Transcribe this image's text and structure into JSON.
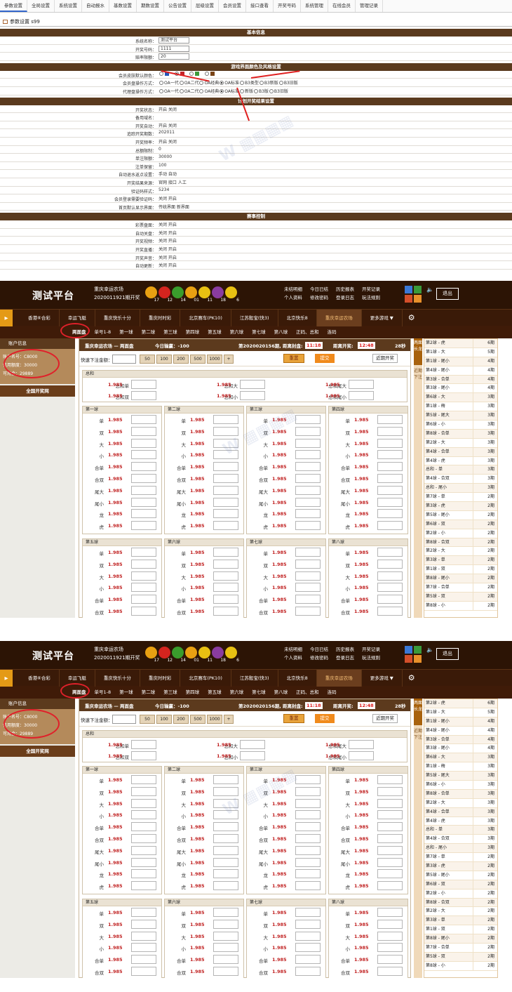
{
  "admin": {
    "tabs": [
      "参数设置",
      "全局设置",
      "系统设置",
      "自动报水",
      "基数设置",
      "期数设置",
      "公告设置",
      "层级设置",
      "会员设置",
      "接口查看",
      "开奖号码",
      "系统管理",
      "在线会员",
      "管理记录"
    ],
    "crumb": "参数设置 s99",
    "h1": "基本信息",
    "rows1": [
      {
        "label": "系统名称：",
        "value": "测试平台"
      },
      {
        "label": "开奖号码：",
        "value": "1111"
      },
      {
        "label": "赔率限额：",
        "value": "20"
      }
    ],
    "h2": "游戏界面颜色及风格设置",
    "color_row": {
      "label": "会员皮肤默认颜色："
    },
    "rows_style": [
      {
        "label": "会员盘操作方式：",
        "options": [
          "OA一代",
          "OA二代",
          "OA经典",
          "OA标准",
          "B3类型",
          "B3新版",
          "B3旧版"
        ]
      },
      {
        "label": "代理盘操作方式：",
        "options": [
          "OA一代",
          "OA二代",
          "OA经典",
          "OA标准",
          "新版",
          "B3版",
          "B3旧版"
        ]
      }
    ],
    "h3": "计划开奖结果设置",
    "rows3": [
      {
        "label": "开奖状态：",
        "value": "开启 关闭"
      },
      {
        "label": "备用域名：",
        "value": ""
      },
      {
        "label": "开奖自动：",
        "value": "开启 关闭"
      },
      {
        "label": "追踪开奖期数：",
        "value": "202011"
      },
      {
        "label": "开奖频率：",
        "value": "开启 关闭"
      },
      {
        "label": "总额限制：",
        "value": "0"
      },
      {
        "label": "单注限额：",
        "value": "30000"
      },
      {
        "label": "注单保留：",
        "value": "100"
      },
      {
        "label": "自动退水返点设置：",
        "value": "手动 自动"
      },
      {
        "label": "开奖结果来源：",
        "value": "官网 接口 人工"
      },
      {
        "label": "验证码样式：",
        "value": "5234"
      },
      {
        "label": "会员登录需要验证码：",
        "value": "关闭 开启"
      },
      {
        "label": "首页默认显示界面：",
        "value": "传统界面 新界面"
      }
    ],
    "h4": "赛事控制",
    "rows4": [
      {
        "label": "彩票盘面：",
        "value": "关闭 开启"
      },
      {
        "label": "自动关盘：",
        "value": "关闭 开启"
      },
      {
        "label": "开奖视频：",
        "value": "关闭 开启"
      },
      {
        "label": "开奖直播：",
        "value": "关闭 开启"
      },
      {
        "label": "开奖声音：",
        "value": "关闭 开启"
      },
      {
        "label": "自动更新：",
        "value": "关闭 开启"
      }
    ]
  },
  "game": {
    "logo": "测试平台",
    "lottery_name": "重庆幸运农场",
    "draw_info": "2020011921期开奖",
    "balls": [
      "17",
      "12",
      "14",
      "01",
      "11",
      "18",
      "6"
    ],
    "ball_colors": [
      "#e8a012",
      "#d4241e",
      "#3a9c2c",
      "#e8a012",
      "#e8c012",
      "#8a3ca0",
      "#e8c012"
    ],
    "links": [
      "未结明细",
      "今日已结",
      "历史报表",
      "开奖记录",
      "个人资料",
      "修改密码",
      "登录日志",
      "玩法规则"
    ],
    "exit": "退出",
    "nav": [
      "香港⑥合彩",
      "幸运飞艇",
      "重庆快乐十分",
      "重庆时时彩",
      "北京赛车(PK10)",
      "江苏骰宝(快3)",
      "北京快乐8",
      "重庆幸运农场",
      "更多游戏 ▼"
    ],
    "sub": [
      "两面盘",
      "单号1-8",
      "第一球",
      "第二球",
      "第三球",
      "第四球",
      "第五球",
      "第六球",
      "第七球",
      "第八球",
      "正码、总和",
      "连码"
    ],
    "side_title": "账户信息",
    "account": [
      "账户名号：C8000",
      "信用额度：30000",
      "可用金：29889"
    ],
    "open_btn": "全国开奖网",
    "head_title": "重庆幸运农场 — 两面盘",
    "today": "今日输赢：-100",
    "issue": "第2020020156期, 距离封盘:",
    "close_time": "11:18",
    "open_label": "距离开奖:",
    "open_time": "12:48",
    "sec": "28秒",
    "quick_label": "快速下注金额：",
    "chips": [
      "50",
      "100",
      "200",
      "500",
      "1000",
      "+"
    ],
    "reset": "重置",
    "submit": "提交",
    "recent": "近期开奖",
    "total_title": "总和",
    "total": [
      "总和单",
      "总和双",
      "总和大",
      "总和小",
      "总和尾大",
      "总和尾小"
    ],
    "ball_titles": [
      "第一球",
      "第二球",
      "第三球",
      "第四球",
      "第五球",
      "第六球",
      "第七球",
      "第八球"
    ],
    "ball_items": [
      "单",
      "双",
      "大",
      "小",
      "合单",
      "合双",
      "尾大",
      "尾小",
      "龙",
      "虎"
    ],
    "odds": "1.985",
    "vtab1": "两面长龙",
    "vtab2": "近期下注",
    "long": [
      [
        "第2球 - 虎",
        "6期"
      ],
      [
        "第1球 - 大",
        "5期"
      ],
      [
        "第1球 - 尾小",
        "4期"
      ],
      [
        "第4球 - 尾小",
        "4期"
      ],
      [
        "第3球 - 合单",
        "4期"
      ],
      [
        "第3球 - 尾小",
        "4期"
      ],
      [
        "第6球 - 大",
        "3期"
      ],
      [
        "第1球 - 梅",
        "3期"
      ],
      [
        "第5球 - 尾大",
        "3期"
      ],
      [
        "第6球 - 小",
        "3期"
      ],
      [
        "第8球 - 合单",
        "3期"
      ],
      [
        "第2球 - 大",
        "3期"
      ],
      [
        "第4球 - 合单",
        "3期"
      ],
      [
        "第4球 - 虎",
        "3期"
      ],
      [
        "总和 - 单",
        "3期"
      ],
      [
        "第4球 - 合双",
        "3期"
      ],
      [
        "总和 - 尾小",
        "3期"
      ],
      [
        "第7球 - 单",
        "2期"
      ],
      [
        "第3球 - 虎",
        "2期"
      ],
      [
        "第5球 - 尾小",
        "2期"
      ],
      [
        "第6球 - 双",
        "2期"
      ],
      [
        "第2球 - 小",
        "2期"
      ],
      [
        "第8球 - 合双",
        "2期"
      ],
      [
        "第2球 - 大",
        "2期"
      ],
      [
        "第3球 - 单",
        "2期"
      ],
      [
        "第1球 - 双",
        "2期"
      ],
      [
        "第8球 - 尾小",
        "2期"
      ],
      [
        "第7球 - 合单",
        "2期"
      ],
      [
        "第5球 - 双",
        "2期"
      ],
      [
        "第8球 - 小",
        "2期"
      ]
    ]
  },
  "game2": {
    "account": [
      "账户名号：C8000",
      "信用额度：30000",
      "可用金：29889"
    ]
  },
  "colors": {
    "brown": "#2c1405",
    "accent": "#e49a16",
    "odds_red": "#c02020"
  }
}
